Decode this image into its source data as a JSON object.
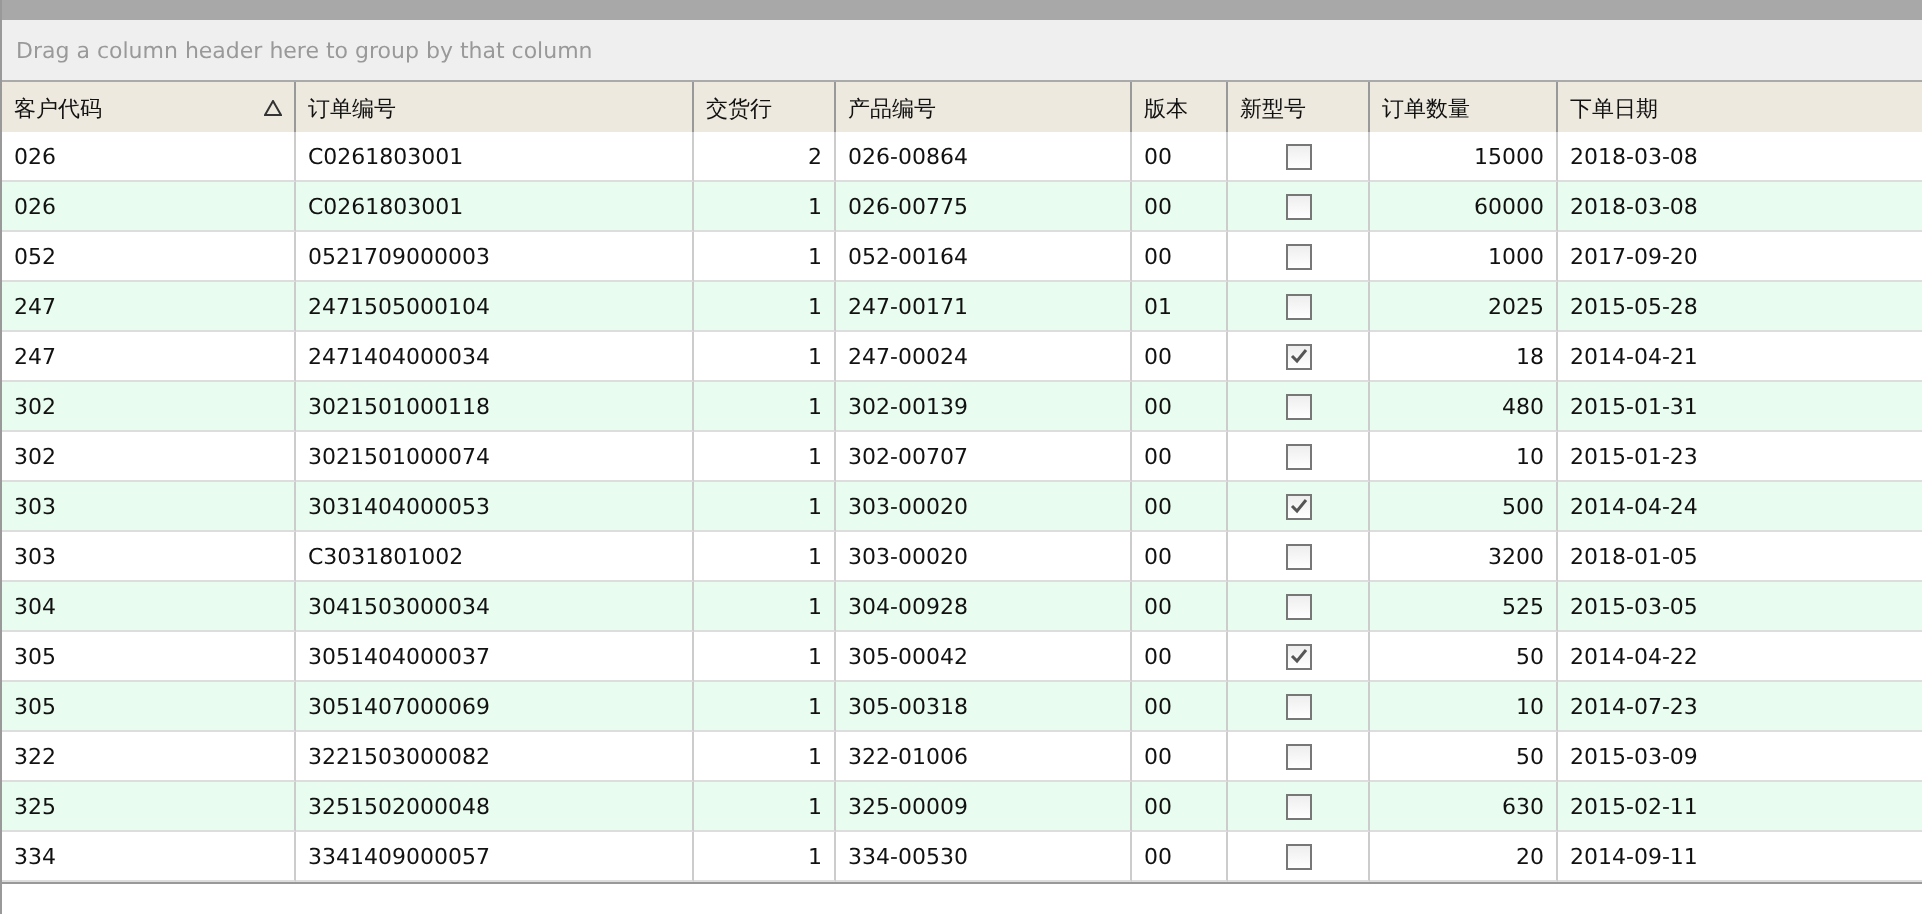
{
  "group_panel": {
    "placeholder": "Drag a column header here to group by that column"
  },
  "table": {
    "columns": [
      {
        "label": "客户代码",
        "kind": "text",
        "sorted_ascending": true
      },
      {
        "label": "订单编号",
        "kind": "text"
      },
      {
        "label": "交货行",
        "kind": "number"
      },
      {
        "label": "产品编号",
        "kind": "text"
      },
      {
        "label": "版本",
        "kind": "text"
      },
      {
        "label": "新型号",
        "kind": "checkbox"
      },
      {
        "label": "订单数量",
        "kind": "number"
      },
      {
        "label": "下单日期",
        "kind": "text"
      }
    ],
    "rows": [
      [
        "026",
        "C0261803001",
        "2",
        "026-00864",
        "00",
        false,
        "15000",
        "2018-03-08"
      ],
      [
        "026",
        "C0261803001",
        "1",
        "026-00775",
        "00",
        false,
        "60000",
        "2018-03-08"
      ],
      [
        "052",
        "0521709000003",
        "1",
        "052-00164",
        "00",
        false,
        "1000",
        "2017-09-20"
      ],
      [
        "247",
        "2471505000104",
        "1",
        "247-00171",
        "01",
        false,
        "2025",
        "2015-05-28"
      ],
      [
        "247",
        "2471404000034",
        "1",
        "247-00024",
        "00",
        true,
        "18",
        "2014-04-21"
      ],
      [
        "302",
        "3021501000118",
        "1",
        "302-00139",
        "00",
        false,
        "480",
        "2015-01-31"
      ],
      [
        "302",
        "3021501000074",
        "1",
        "302-00707",
        "00",
        false,
        "10",
        "2015-01-23"
      ],
      [
        "303",
        "3031404000053",
        "1",
        "303-00020",
        "00",
        true,
        "500",
        "2014-04-24"
      ],
      [
        "303",
        "C3031801002",
        "1",
        "303-00020",
        "00",
        false,
        "3200",
        "2018-01-05"
      ],
      [
        "304",
        "3041503000034",
        "1",
        "304-00928",
        "00",
        false,
        "525",
        "2015-03-05"
      ],
      [
        "305",
        "3051404000037",
        "1",
        "305-00042",
        "00",
        true,
        "50",
        "2014-04-22"
      ],
      [
        "305",
        "3051407000069",
        "1",
        "305-00318",
        "00",
        false,
        "10",
        "2014-07-23"
      ],
      [
        "322",
        "3221503000082",
        "1",
        "322-01006",
        "00",
        false,
        "50",
        "2015-03-09"
      ],
      [
        "325",
        "3251502000048",
        "1",
        "325-00009",
        "00",
        false,
        "630",
        "2015-02-11"
      ],
      [
        "334",
        "3341409000057",
        "1",
        "334-00530",
        "00",
        false,
        "20",
        "2014-09-11"
      ]
    ]
  }
}
